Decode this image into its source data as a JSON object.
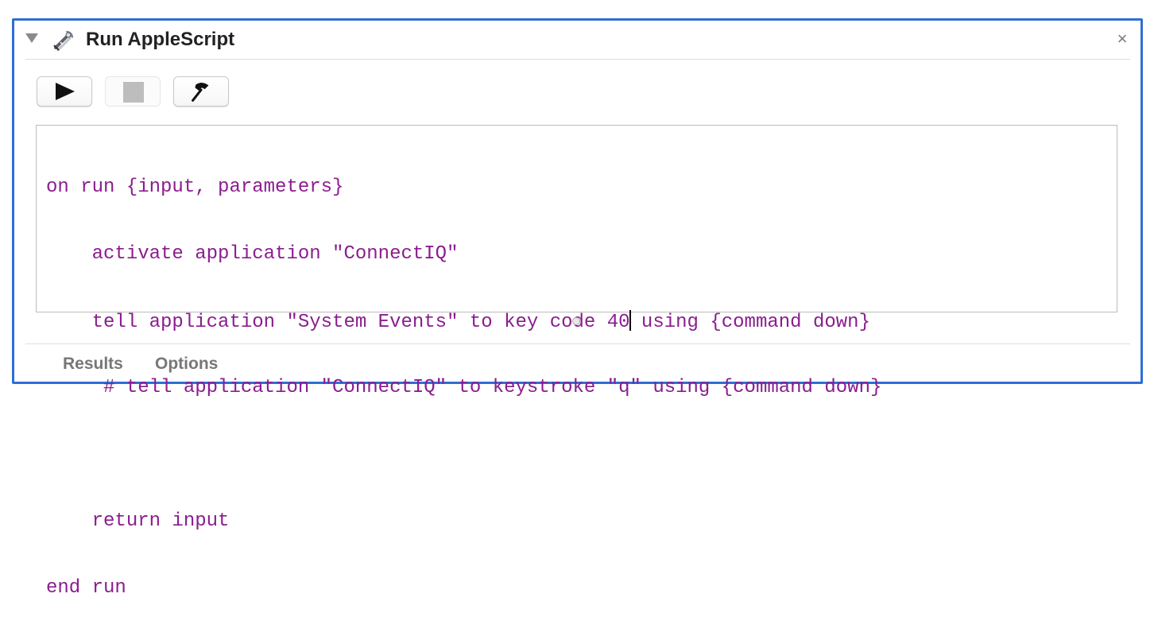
{
  "action": {
    "title": "Run AppleScript",
    "icon": "applescript-script-icon",
    "close_glyph": "×"
  },
  "toolbar": {
    "buttons": [
      {
        "name": "run-button",
        "icon": "play-icon",
        "enabled": true
      },
      {
        "name": "stop-button",
        "icon": "stop-icon",
        "enabled": false
      },
      {
        "name": "compile-button",
        "icon": "hammer-icon",
        "enabled": true
      }
    ]
  },
  "editor": {
    "lines": [
      "on run {input, parameters}",
      "    activate application \"ConnectIQ\"",
      "    tell application \"System Events\" to key code 40",
      " using {command down}",
      "     # tell application \"ConnectIQ\" to keystroke \"q\" using {command down}",
      "",
      "    return input",
      "end run"
    ],
    "text_color": "#8b1d8f"
  },
  "footer": {
    "tabs": [
      "Results",
      "Options"
    ]
  },
  "colors": {
    "selection_border": "#2d6fd6"
  }
}
